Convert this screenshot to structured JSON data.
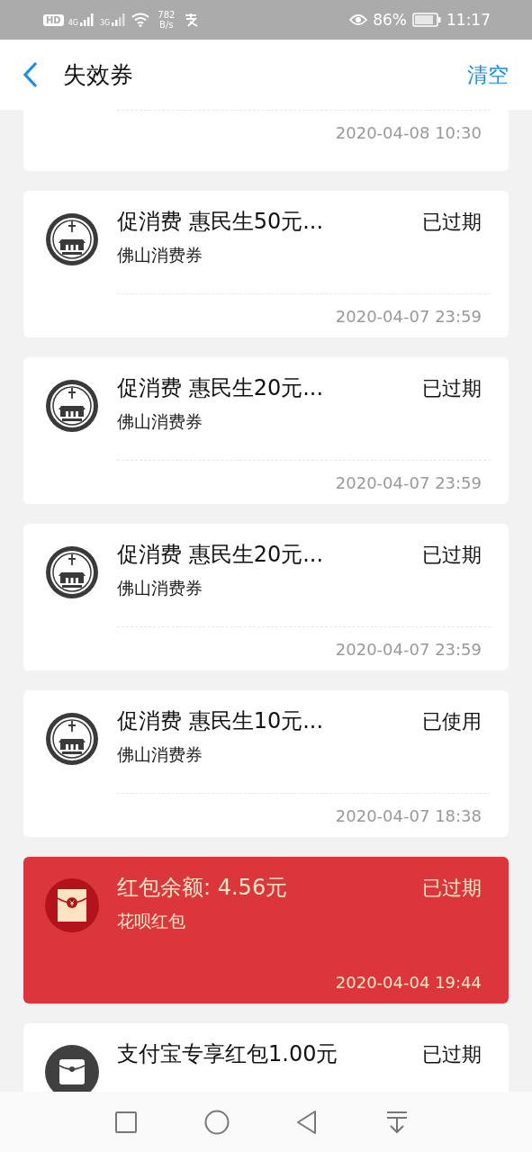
{
  "status_bar": {
    "hd": "HD",
    "sim1": "4G",
    "sim2": "3G",
    "speed_value": "782",
    "speed_unit": "B/s",
    "battery": "86%",
    "time": "11:17"
  },
  "header": {
    "title": "失效券",
    "action": "清空"
  },
  "cards": [
    {
      "kind": "seal",
      "partial": true,
      "date": "2020-04-08 10:30"
    },
    {
      "kind": "seal",
      "title": "促消费 惠民生50元...",
      "subtitle": "佛山消费券",
      "status": "已过期",
      "date": "2020-04-07 23:59"
    },
    {
      "kind": "seal",
      "title": "促消费 惠民生20元...",
      "subtitle": "佛山消费券",
      "status": "已过期",
      "date": "2020-04-07 23:59"
    },
    {
      "kind": "seal",
      "title": "促消费 惠民生20元...",
      "subtitle": "佛山消费券",
      "status": "已过期",
      "date": "2020-04-07 23:59"
    },
    {
      "kind": "seal",
      "title": "促消费 惠民生10元...",
      "subtitle": "佛山消费券",
      "status": "已使用",
      "date": "2020-04-07 18:38"
    },
    {
      "kind": "red_packet",
      "title": "红包余额: 4.56元",
      "subtitle": "花呗红包",
      "status": "已过期",
      "date": "2020-04-04 19:44"
    },
    {
      "kind": "envelope",
      "title": "支付宝专享红包1.00元",
      "status": "已过期"
    }
  ]
}
